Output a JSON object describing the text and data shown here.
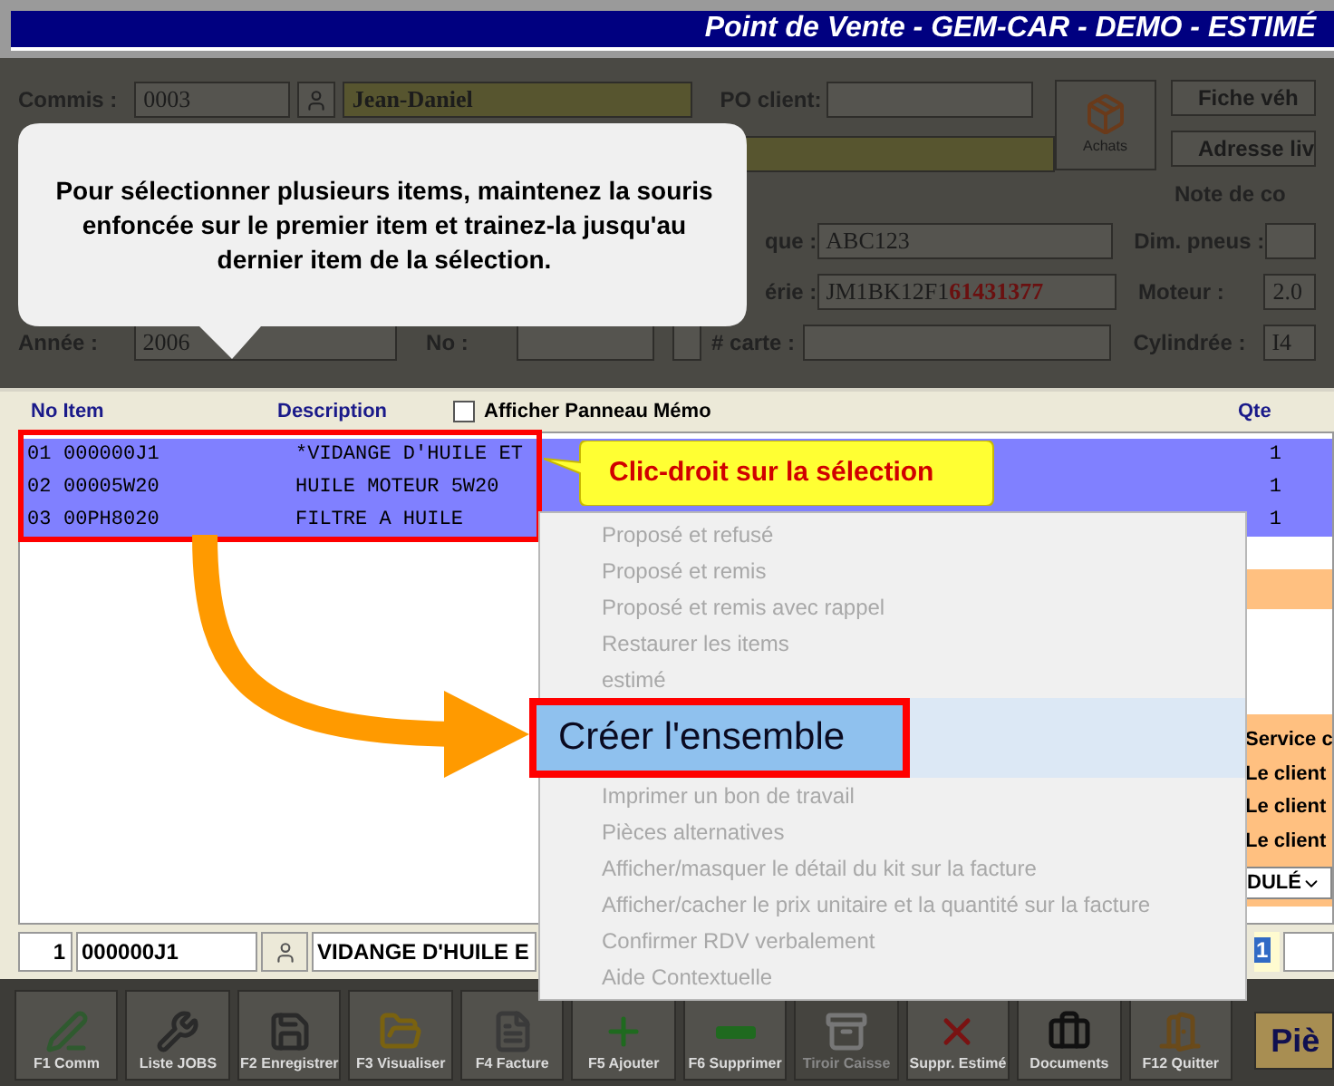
{
  "window": {
    "title": "Point de Vente - GEM-CAR - DEMO - ESTIMÉ"
  },
  "form": {
    "commis_label": "Commis :",
    "commis_code": "0003",
    "commis_name": "Jean-Daniel",
    "po_label": "PO client:",
    "achats": "Achats",
    "buttons": [
      "Fiche véh",
      "Adresse liv"
    ],
    "note_label": "Note de co",
    "plaque_label": "que :",
    "plaque": "ABC123",
    "pneus_label": "Dim. pneus :",
    "serie_label": "érie :",
    "serie_start": "JM1BK12F1",
    "serie_end": "61431377",
    "moteur_label": "Moteur :",
    "moteur": "2.0",
    "annee_label": "Année :",
    "annee": "2006",
    "no_label": "No :",
    "carte_label": "# carte :",
    "cylindree_label": "Cylindrée :",
    "cylindree": "I4"
  },
  "tip": {
    "text": "Pour sélectionner plusieurs items, maintenez la souris enfoncée sur le premier item et trainez-la jusqu'au dernier item de la sélection."
  },
  "grid": {
    "columns": [
      "No Item",
      "Description",
      "Qte"
    ],
    "memo": {
      "label": "Afficher Panneau Mémo",
      "checked": false
    },
    "rows": [
      {
        "no": "01",
        "item": "000000J1",
        "description": "*VIDANGE D'HUILE ET",
        "qte": "1",
        "selected": true
      },
      {
        "no": "02",
        "item": "00005W20",
        "description": "HUILE MOTEUR 5W20",
        "qte": "1",
        "selected": true
      },
      {
        "no": "03",
        "item": "00PH8020",
        "description": "FILTRE A HUILE",
        "qte": "1",
        "selected": true
      }
    ]
  },
  "callout": "Clic-droit sur la sélection",
  "context_menu": {
    "items": [
      {
        "label": "Proposé et refusé",
        "disabled": true,
        "selected": false
      },
      {
        "label": "Proposé et remis",
        "disabled": true,
        "selected": false
      },
      {
        "label": "Proposé et remis avec rappel",
        "disabled": true,
        "selected": false
      },
      {
        "label": "Restaurer les items",
        "disabled": true,
        "selected": false
      },
      {
        "label": "estimé",
        "disabled": true,
        "selected": false
      },
      {
        "label": "Créer l'ensemble",
        "disabled": false,
        "selected": true
      },
      {
        "label": "Imprimer un bon de travail",
        "disabled": true,
        "selected": false
      },
      {
        "label": "Pièces alternatives",
        "disabled": true,
        "selected": false
      },
      {
        "label": "Afficher/masquer le détail du kit sur la facture",
        "disabled": true,
        "selected": false
      },
      {
        "label": "Afficher/cacher le prix unitaire et la quantité sur la facture",
        "disabled": true,
        "selected": false
      },
      {
        "label": "Confirmer RDV verbalement",
        "disabled": true,
        "selected": false
      },
      {
        "label": "Aide Contextuelle",
        "disabled": true,
        "selected": false
      }
    ]
  },
  "side_panel": {
    "lines": [
      "Service c",
      "Le client",
      "Le client",
      "Le client"
    ],
    "dropdown": "DULÉ"
  },
  "entry_line": {
    "line": "1",
    "item": "000000J1",
    "description": "VIDANGE D'HUILE E",
    "qte": "1"
  },
  "toolbar": [
    {
      "label": "F1 Comm",
      "kind": "pen",
      "disabled": false
    },
    {
      "label": "Liste JOBS",
      "kind": "wrench",
      "disabled": false
    },
    {
      "label": "F2 Enregistrer",
      "kind": "save",
      "disabled": false
    },
    {
      "label": "F3 Visualiser",
      "kind": "folder",
      "disabled": false
    },
    {
      "label": "F4 Facture",
      "kind": "file",
      "disabled": false
    },
    {
      "label": "F5 Ajouter",
      "kind": "plus",
      "disabled": false
    },
    {
      "label": "F6 Supprimer",
      "kind": "minus",
      "disabled": false
    },
    {
      "label": "Tiroir Caisse",
      "kind": "drawer",
      "disabled": true
    },
    {
      "label": "Suppr. Estimé",
      "kind": "delete",
      "disabled": false
    },
    {
      "label": "Documents",
      "kind": "briefcase",
      "disabled": false
    },
    {
      "label": "F12 Quitter",
      "kind": "exit",
      "disabled": false
    }
  ],
  "side_button": "Piè"
}
